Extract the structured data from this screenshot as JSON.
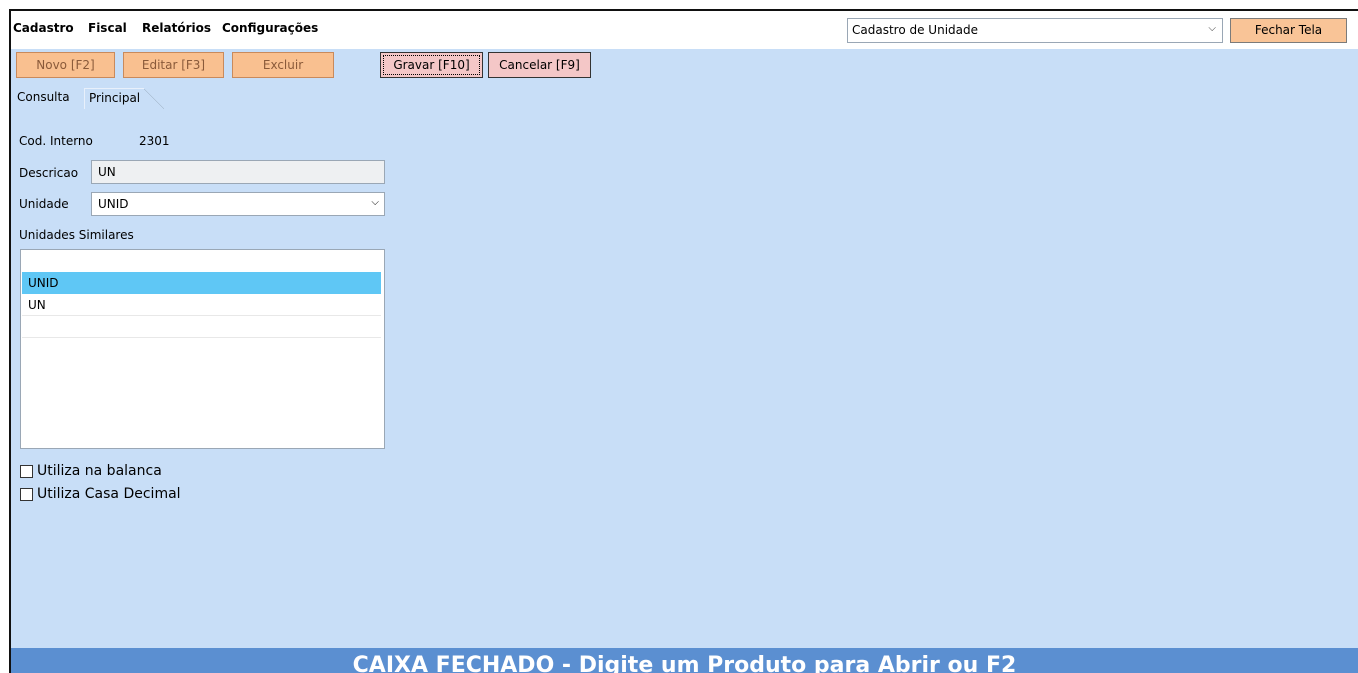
{
  "menu": {
    "items": [
      "Cadastro",
      "Fiscal",
      "Relatórios",
      "Configurações"
    ]
  },
  "header": {
    "screen_select_value": "Cadastro de Unidade",
    "close_label": "Fechar Tela"
  },
  "toolbar": {
    "novo": "Novo [F2]",
    "editar": "Editar [F3]",
    "excluir": "Excluir",
    "gravar": "Gravar [F10]",
    "cancelar": "Cancelar [F9]"
  },
  "tabs": {
    "consulta": "Consulta",
    "principal": "Principal"
  },
  "form": {
    "cod_interno_label": "Cod. Interno",
    "cod_interno_value": "2301",
    "descricao_label": "Descricao",
    "descricao_value": "UN",
    "unidade_label": "Unidade",
    "unidade_value": "UNID",
    "similares_label": "Unidades Similares",
    "similares": [
      "",
      "UNID",
      "UN",
      ""
    ],
    "selected_index": 1,
    "check_balanca": "Utiliza na balanca",
    "check_decimal": "Utiliza Casa Decimal"
  },
  "status": {
    "message": "CAIXA FECHADO - Digite um Produto para Abrir ou F2"
  },
  "colors": {
    "background": "#c8def7",
    "button_orange": "#f9c090",
    "selected_row": "#5fc7f5",
    "status_bar": "#5b8fd1"
  }
}
